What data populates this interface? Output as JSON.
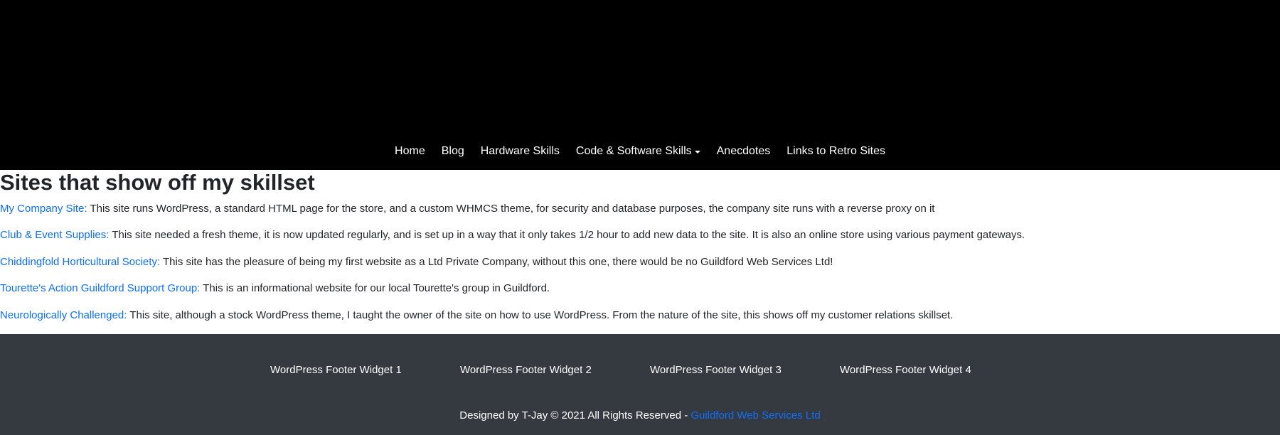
{
  "nav": {
    "items": [
      {
        "label": "Home"
      },
      {
        "label": "Blog"
      },
      {
        "label": "Hardware Skills"
      },
      {
        "label": "Code & Software Skills"
      },
      {
        "label": "Anecdotes"
      },
      {
        "label": "Links to Retro Sites"
      }
    ]
  },
  "main": {
    "title": "Sites that show off my skillset",
    "sites": [
      {
        "link": "My Company Site:",
        "desc": " This site runs WordPress, a standard HTML page for the store, and a custom WHMCS theme, for security and database purposes, the company site runs with a reverse proxy on it"
      },
      {
        "link": "Club & Event Supplies:",
        "desc": " This site needed a fresh theme, it is now updated regularly, and is set up in a way that it only takes 1/2 hour to add new data to the site. It is also an online store using various payment gateways."
      },
      {
        "link": "Chiddingfold Horticultural Society:",
        "desc": " This site has the pleasure of being my first website as a Ltd Private Company, without this one, there would be no Guildford Web Services Ltd!"
      },
      {
        "link": "Tourette's Action Guildford Support Group:",
        "desc": " This is an informational website for our local Tourette's group in Guildford."
      },
      {
        "link": "Neurologically Challenged:",
        "desc": " This site, although a stock WordPress theme, I taught the owner of the site on how to use WordPress. From the nature of the site, this shows off my customer relations skillset."
      }
    ]
  },
  "footer": {
    "widgets": [
      {
        "label": "WordPress Footer Widget 1"
      },
      {
        "label": "WordPress Footer Widget 2"
      },
      {
        "label": "WordPress Footer Widget 3"
      },
      {
        "label": "WordPress Footer Widget 4"
      }
    ],
    "copyright_text": "Designed by T-Jay © 2021 All Rights Reserved - ",
    "copyright_link": "Guildford Web Services Ltd"
  },
  "colors": {
    "header_bg": "#000000",
    "footer_bg": "#343a40",
    "link": "#0d6efd",
    "text": "#212529"
  }
}
